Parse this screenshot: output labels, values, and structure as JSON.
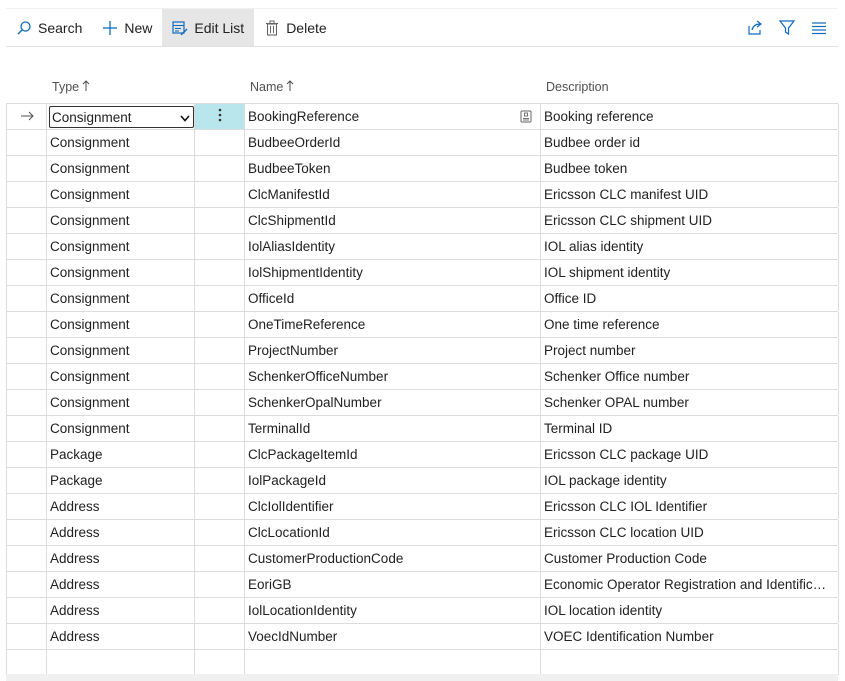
{
  "toolbar": {
    "search_label": "Search",
    "new_label": "New",
    "edit_list_label": "Edit List",
    "delete_label": "Delete"
  },
  "columns": {
    "type": "Type",
    "name": "Name",
    "description": "Description"
  },
  "rows": [
    {
      "type": "Consignment",
      "name": "BookingReference",
      "description": "Booking reference"
    },
    {
      "type": "Consignment",
      "name": "BudbeeOrderId",
      "description": "Budbee order id"
    },
    {
      "type": "Consignment",
      "name": "BudbeeToken",
      "description": "Budbee token"
    },
    {
      "type": "Consignment",
      "name": "ClcManifestId",
      "description": "Ericsson CLC manifest UID"
    },
    {
      "type": "Consignment",
      "name": "ClcShipmentId",
      "description": "Ericsson CLC shipment UID"
    },
    {
      "type": "Consignment",
      "name": "IolAliasIdentity",
      "description": "IOL alias identity"
    },
    {
      "type": "Consignment",
      "name": "IolShipmentIdentity",
      "description": "IOL shipment identity"
    },
    {
      "type": "Consignment",
      "name": "OfficeId",
      "description": "Office ID"
    },
    {
      "type": "Consignment",
      "name": "OneTimeReference",
      "description": "One time reference"
    },
    {
      "type": "Consignment",
      "name": "ProjectNumber",
      "description": "Project number"
    },
    {
      "type": "Consignment",
      "name": "SchenkerOfficeNumber",
      "description": "Schenker Office number"
    },
    {
      "type": "Consignment",
      "name": "SchenkerOpalNumber",
      "description": "Schenker OPAL number"
    },
    {
      "type": "Consignment",
      "name": "TerminalId",
      "description": "Terminal ID"
    },
    {
      "type": "Package",
      "name": "ClcPackageItemId",
      "description": "Ericsson CLC package UID"
    },
    {
      "type": "Package",
      "name": "IolPackageId",
      "description": "IOL package identity"
    },
    {
      "type": "Address",
      "name": "ClcIolIdentifier",
      "description": "Ericsson CLC IOL Identifier"
    },
    {
      "type": "Address",
      "name": "ClcLocationId",
      "description": "Ericsson CLC location UID"
    },
    {
      "type": "Address",
      "name": "CustomerProductionCode",
      "description": "Customer Production Code"
    },
    {
      "type": "Address",
      "name": "EoriGB",
      "description": "Economic Operator Registration and Identification"
    },
    {
      "type": "Address",
      "name": "IolLocationIdentity",
      "description": "IOL location identity"
    },
    {
      "type": "Address",
      "name": "VoecIdNumber",
      "description": "VOEC Identification Number"
    }
  ],
  "selected_row_index": 0,
  "colors": {
    "accent": "#0f6cbd",
    "selected_action_bg": "#b8e6ec",
    "grid_line": "#dcdcdc"
  }
}
